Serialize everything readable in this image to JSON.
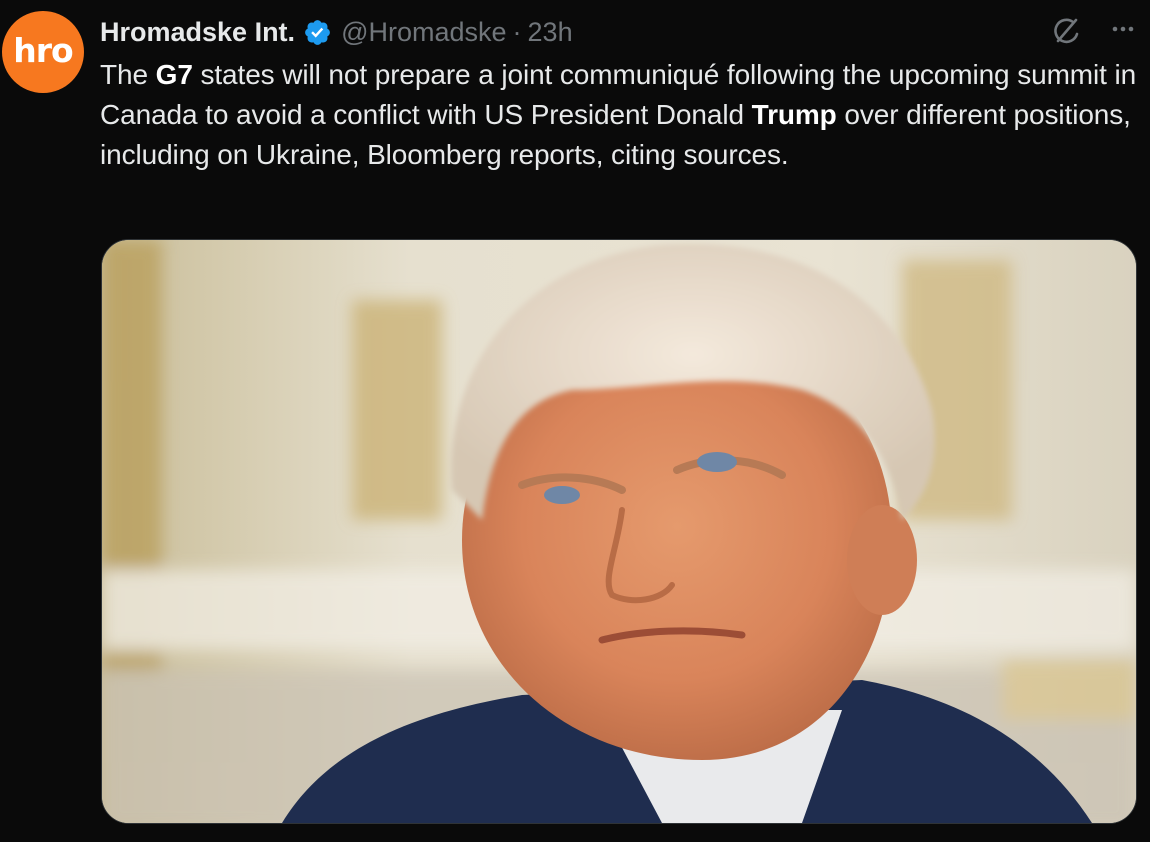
{
  "author": {
    "avatar_text": "hro",
    "name": "Hromadske Int.",
    "handle": "@Hromadske",
    "separator": "·",
    "time": "23h",
    "verified": true,
    "avatar_color": "#f7781f",
    "verified_color": "#1d9bf0"
  },
  "tweet": {
    "text_segments": [
      {
        "text": "The ",
        "bold": false
      },
      {
        "text": "G7",
        "bold": true
      },
      {
        "text": " states will not prepare a joint communiqué following the upcoming summit in Canada to avoid a conflict with US President Donald ",
        "bold": false
      },
      {
        "text": "Trump",
        "bold": true
      },
      {
        "text": " over different positions, including on Ukraine, Bloomberg reports, citing sources.",
        "bold": false
      }
    ]
  },
  "icons": {
    "verified": "verified-badge-icon",
    "grok": "grok-icon",
    "more": "more-options-icon"
  },
  "media": {
    "type": "photo",
    "subject": "portrait photo"
  }
}
